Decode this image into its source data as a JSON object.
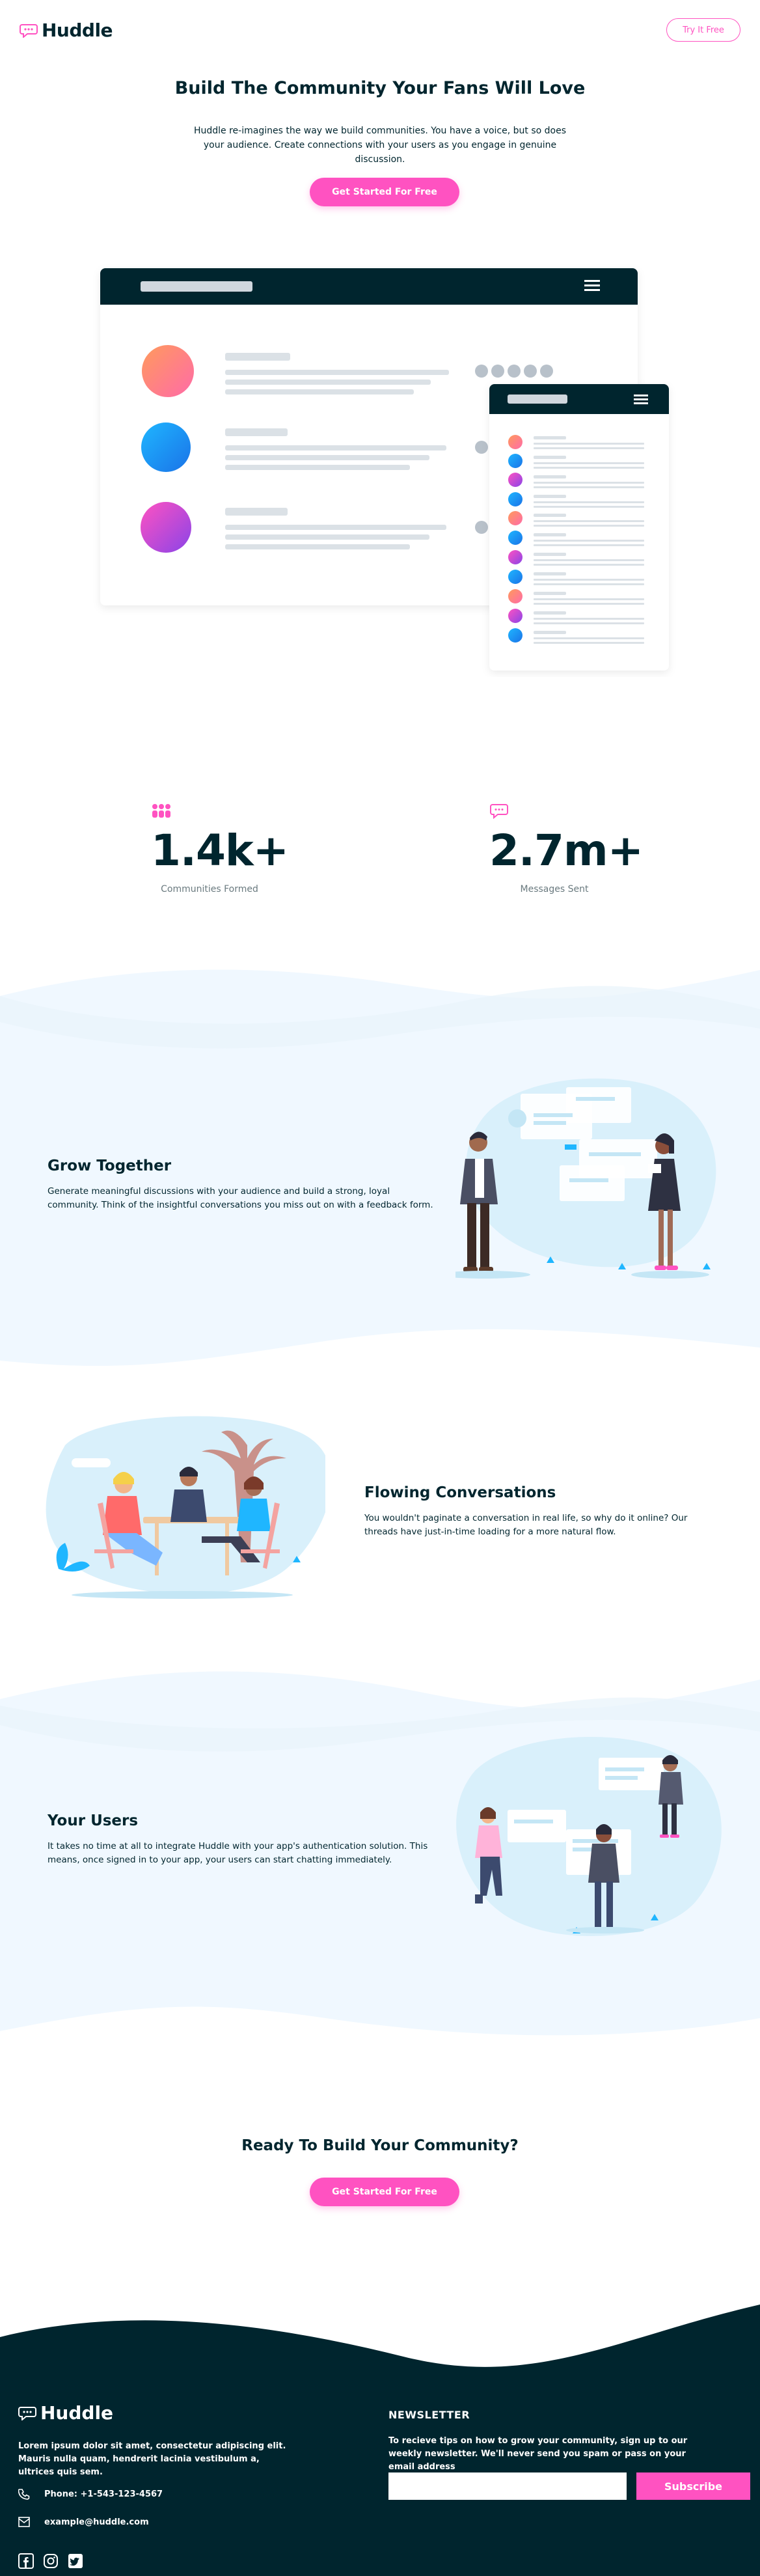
{
  "header": {
    "logo_text": "Huddle",
    "try_button": "Try It Free"
  },
  "hero": {
    "title": "Build The Community Your Fans Will Love",
    "text": "Huddle re-imagines the way we build communities. You have a voice, but so does your audience. Create connections with your users as you engage in genuine discussion.",
    "cta": "Get Started For Free"
  },
  "stats": [
    {
      "value": "1.4k+",
      "label": "Communities Formed",
      "icon": "communities-icon"
    },
    {
      "value": "2.7m+",
      "label": "Messages Sent",
      "icon": "messages-icon"
    }
  ],
  "features": [
    {
      "title": "Grow Together",
      "text": "Generate meaningful discussions with your audience and build a strong, loyal community. Think of the insightful conversations you miss out on with a feedback form."
    },
    {
      "title": "Flowing Conversations",
      "text": "You wouldn't paginate a conversation in real life, so why do it online? Our threads have just-in-time loading for a more natural flow."
    },
    {
      "title": "Your Users",
      "text": "It takes no time at all to integrate Huddle with your app's authentication solution. This means, once signed in to your app, your users can start chatting immediately."
    }
  ],
  "ready": {
    "title": "Ready To Build Your Community?",
    "cta": "Get Started For Free"
  },
  "footer": {
    "logo_text": "Huddle",
    "about": "Lorem ipsum dolor sit amet, consectetur adipiscing elit. Mauris nulla quam, hendrerit lacinia vestibulum a, ultrices quis sem.",
    "phone": "Phone: +1-543-123-4567",
    "email": "example@huddle.com",
    "newsletter_title": "NEWSLETTER",
    "newsletter_text": "To recieve tips on how to grow your community, sign up to our weekly newsletter. We'll never send you spam or pass on your email address",
    "email_value": "",
    "subscribe": "Subscribe"
  },
  "colors": {
    "pink": "#ff52c1",
    "dark": "#00252e",
    "light_blue": "#f0f8ff"
  }
}
